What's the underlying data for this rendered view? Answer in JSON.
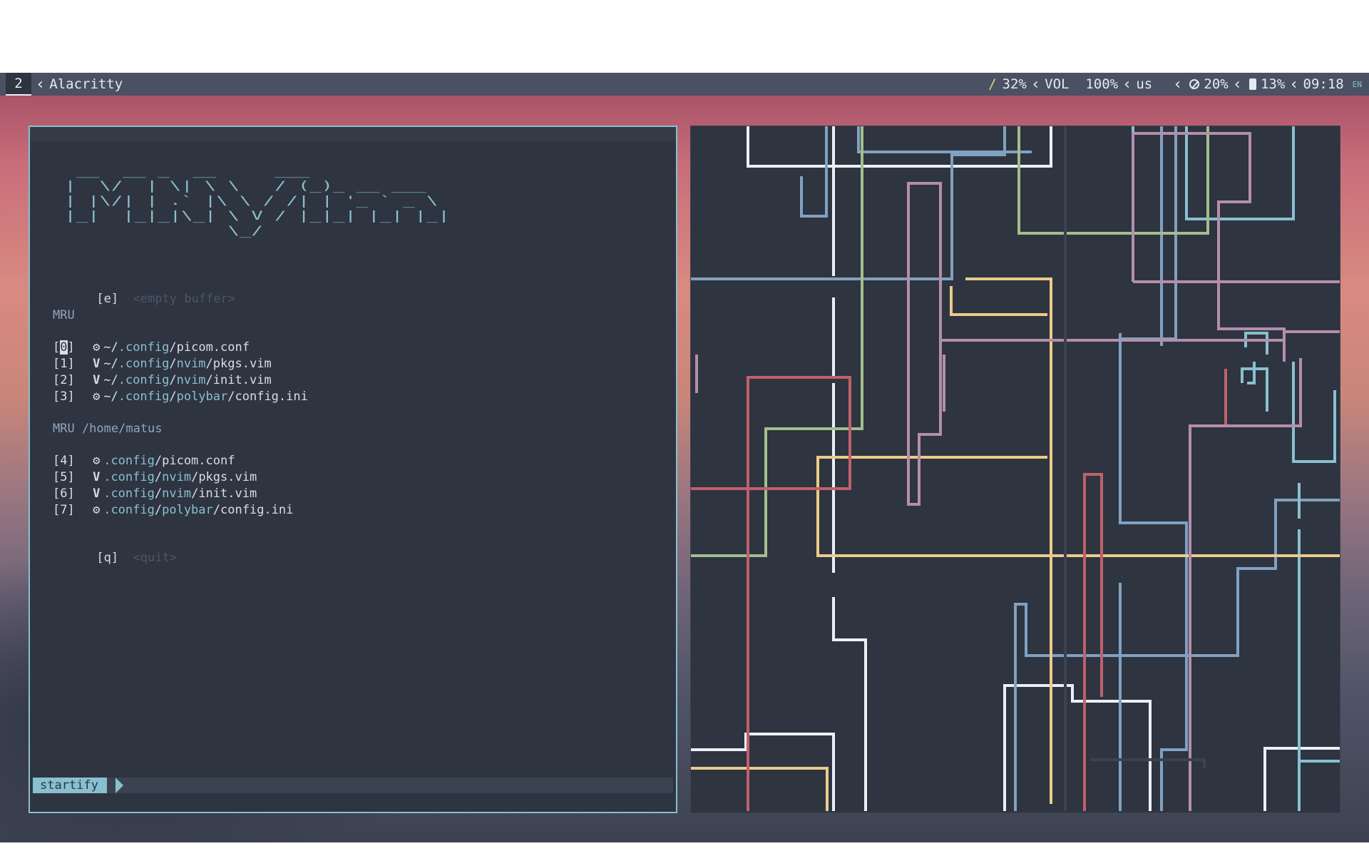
{
  "topbar": {
    "workspace": "2",
    "window_title": "Alacritty",
    "slash": "/",
    "cpu": "32%",
    "vol_label": "VOL",
    "vol_value": "100%",
    "layout": "us",
    "brightness": "20%",
    "battery": "13%",
    "clock": "09:18",
    "lang_badge": "EN"
  },
  "startify": {
    "logo": "  __  __ _  __     ___            \n |  \\/  | \\| \\ \\   / (_)_ __ ___  \n | |\\/| | .` |\\ \\ / /| | '_ ` _ \\ \n |_|  |_|_|\\_| \\ V / |_|_| |_| |_|\n               \\_/                ",
    "empty": {
      "key": "[e]",
      "label": "<empty buffer>"
    },
    "mru_header": "MRU",
    "mru_items": [
      {
        "key_open": "[",
        "key_num": "0",
        "key_close": "]",
        "icon": "gear",
        "prefix": "~/",
        "dir": ".config",
        "sep": "/",
        "file": "picom.conf"
      },
      {
        "key": "[1]",
        "icon": "vim",
        "prefix": "~/",
        "dir1": ".config",
        "dir2": "nvim",
        "file": "pkgs.vim"
      },
      {
        "key": "[2]",
        "icon": "vim",
        "prefix": "~/",
        "dir1": ".config",
        "dir2": "nvim",
        "file": "init.vim"
      },
      {
        "key": "[3]",
        "icon": "gear",
        "prefix": "~/",
        "dir1": ".config",
        "dir2": "polybar",
        "file": "config.ini"
      }
    ],
    "mru_home_header": "MRU /home/matus",
    "home_items": [
      {
        "key": "[4]",
        "icon": "gear",
        "dir1": ".config",
        "file": "picom.conf"
      },
      {
        "key": "[5]",
        "icon": "vim",
        "dir1": ".config",
        "dir2": "nvim",
        "file": "pkgs.vim"
      },
      {
        "key": "[6]",
        "icon": "vim",
        "dir1": ".config",
        "dir2": "nvim",
        "file": "init.vim"
      },
      {
        "key": "[7]",
        "icon": "gear",
        "dir1": ".config",
        "dir2": "polybar",
        "file": "config.ini"
      }
    ],
    "quit": {
      "key": "[q]",
      "label": "<quit>"
    },
    "mode": "startify"
  },
  "colors": {
    "accent": "#88c0d0",
    "pipe_white": "#eceff4",
    "pipe_blue": "#81a1c1",
    "pipe_green": "#a3be8c",
    "pipe_yellow": "#ebcb8b",
    "pipe_red": "#bf616a",
    "pipe_purple": "#b48ead",
    "pipe_cyan": "#88c0d0"
  }
}
